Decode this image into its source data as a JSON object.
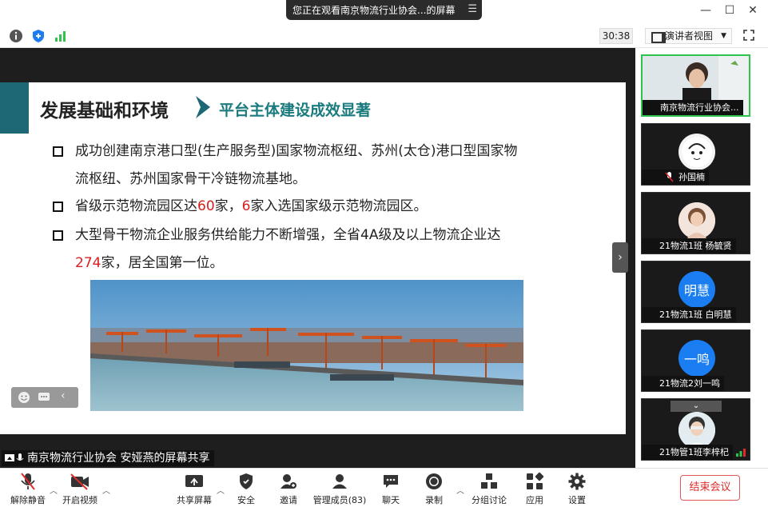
{
  "window": {
    "title": "您正在观看南京物流行业协会...的屏幕",
    "timer": "30:38",
    "view_mode": "演讲者视图"
  },
  "slide": {
    "heading": "发展基础和环境",
    "subheading": "平台主体建设成效显著",
    "bullets": [
      {
        "line1": "成功创建南京港口型(生产服务型)国家物流枢纽、苏州(太仓)港口型国家物",
        "line2": "流枢纽、苏州国家骨干冷链物流基地。"
      },
      {
        "pre": "省级示范物流园区达",
        "num1": "60",
        "mid": "家，",
        "num2": "6",
        "post": "家入选国家级示范物流园区。"
      },
      {
        "line1": "大型骨干物流企业服务供给能力不断增强，全省4A级及以上物流企业达",
        "num": "274",
        "line2": "家，居全国第一位。"
      }
    ]
  },
  "share_label": "南京物流行业协会 安娅燕的屏幕共享",
  "participants": [
    {
      "name": "南京物流行业协会...",
      "type": "video",
      "active": true
    },
    {
      "name": "孙国楠",
      "type": "avatar-photo"
    },
    {
      "name": "21物流1班 杨毓贤",
      "type": "avatar-photo"
    },
    {
      "name": "21物流1班 白明慧",
      "type": "avatar-text",
      "initials": "明慧"
    },
    {
      "name": "21物流2刘一鸣",
      "type": "avatar-text",
      "initials": "一鸣"
    },
    {
      "name": "21物管1班李梓杞",
      "type": "avatar-photo"
    }
  ],
  "toolbar": {
    "unmute": "解除静音",
    "video": "开启视频",
    "share": "共享屏幕",
    "security": "安全",
    "invite": "邀请",
    "members": "管理成员(83)",
    "chat": "聊天",
    "record": "录制",
    "breakout": "分组讨论",
    "apps": "应用",
    "settings": "设置",
    "end": "结束会议"
  },
  "colors": {
    "accent_green": "#2fc24d",
    "teal": "#1a7b7e",
    "red": "#d81e1e",
    "blue": "#1a7ef2"
  }
}
